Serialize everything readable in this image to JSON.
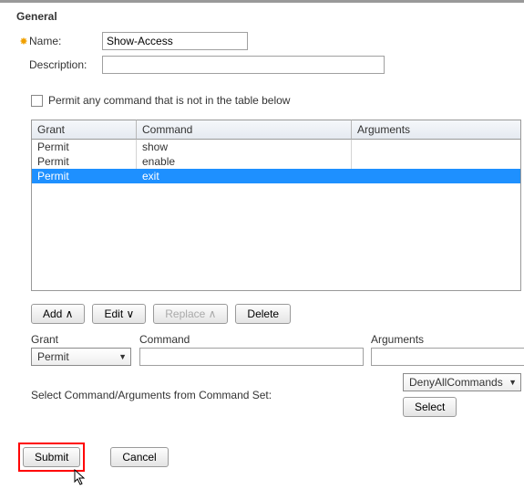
{
  "section": {
    "title": "General"
  },
  "labels": {
    "name": "Name:",
    "description": "Description:",
    "permit_any": "Permit any command that is not in the table below",
    "grant": "Grant",
    "command": "Command",
    "arguments": "Arguments",
    "select_from_set": "Select Command/Arguments from Command Set:"
  },
  "form": {
    "name": "Show-Access",
    "description": "",
    "permit_any_checked": false
  },
  "table": {
    "headers": {
      "grant": "Grant",
      "command": "Command",
      "arguments": "Arguments"
    },
    "rows": [
      {
        "grant": "Permit",
        "command": "show",
        "arguments": "",
        "selected": false
      },
      {
        "grant": "Permit",
        "command": "enable",
        "arguments": "",
        "selected": false
      },
      {
        "grant": "Permit",
        "command": "exit",
        "arguments": "",
        "selected": true
      }
    ]
  },
  "buttons": {
    "add": "Add ∧",
    "edit": "Edit ∨",
    "replace": "Replace ∧",
    "delete": "Delete",
    "select": "Select",
    "submit": "Submit",
    "cancel": "Cancel"
  },
  "edit": {
    "grant_value": "Permit",
    "command_value": "",
    "arguments_value": ""
  },
  "command_set": {
    "selected": "DenyAllCommands"
  }
}
